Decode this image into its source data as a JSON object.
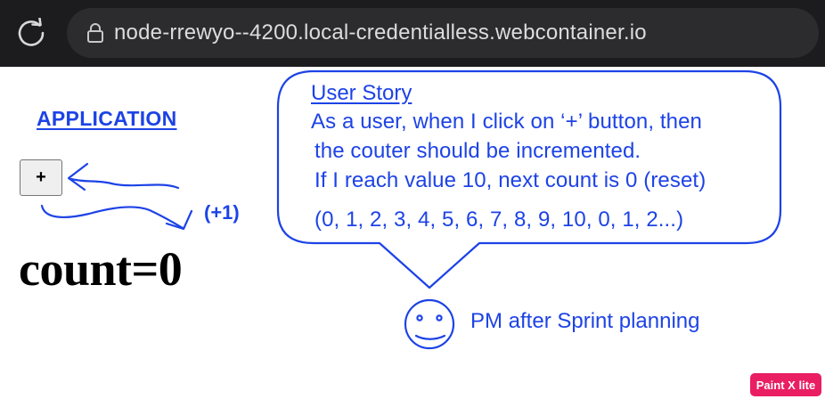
{
  "browser": {
    "url": "node-rrewyo--4200.local-credentialless.webcontainer.io",
    "reload_icon": "reload-icon",
    "lock_icon": "lock-icon"
  },
  "app": {
    "heading": "APPLICATION",
    "plus_button_label": "+",
    "count_text": "count=0"
  },
  "annotations": {
    "increment_note": "(+1)",
    "user_story": {
      "title": "User Story",
      "lines": [
        "As a user, when I click on ‘+’ button, then",
        "the couter should be incremented.",
        "If I reach value 10, next count is 0 (reset)",
        "(0, 1, 2, 3, 4, 5, 6, 7, 8, 9, 10, 0, 1, 2...)"
      ]
    },
    "pm_icon": "smiley-face-icon",
    "pm_caption": "PM after Sprint planning",
    "accent_color": "#1d43e6"
  },
  "watermark": {
    "badge_text": "Paint X lite",
    "badge_color": "#e91e63"
  }
}
